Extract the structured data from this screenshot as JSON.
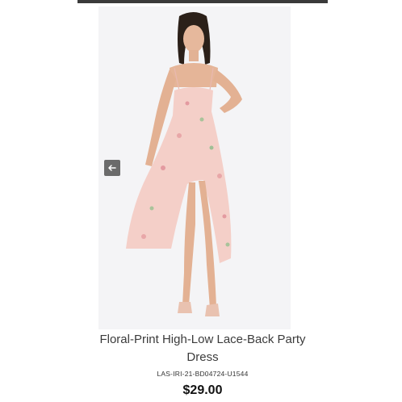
{
  "product": {
    "title": "Floral-Print High-Low Lace-Back Party Dress",
    "sku": "LAS-IRI-21-BD04724-U1544",
    "price": "$29.00"
  },
  "gallery": {
    "prev_icon": "arrow-left-icon",
    "background": "#f4f4f6",
    "dress_color": "#f4cfc8",
    "shoe_color": "#e9c2b0"
  }
}
